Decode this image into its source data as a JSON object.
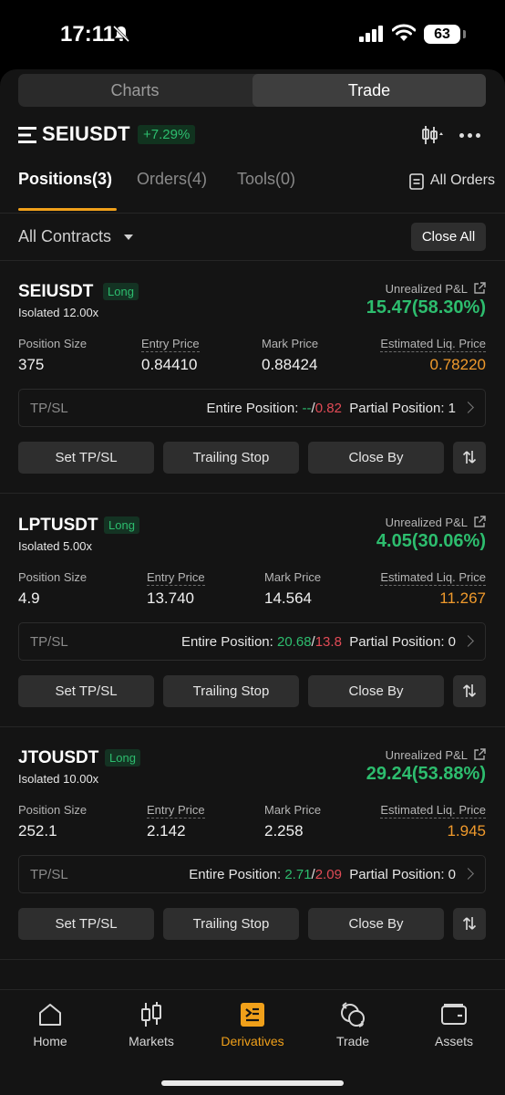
{
  "status_bar": {
    "time": "17:11",
    "battery": "63"
  },
  "segment": {
    "charts": "Charts",
    "trade": "Trade"
  },
  "header": {
    "pair": "SEIUSDT",
    "change": "+7.29%"
  },
  "tabs": {
    "positions": "Positions(3)",
    "orders": "Orders(4)",
    "tools": "Tools(0)",
    "all_orders": "All Orders"
  },
  "filter": {
    "contracts": "All Contracts",
    "close_all": "Close All"
  },
  "labels": {
    "unrealized_pnl": "Unrealized P&L",
    "position_size": "Position Size",
    "entry_price": "Entry Price",
    "mark_price": "Mark Price",
    "liq_price": "Estimated Liq. Price",
    "tpsl": "TP/SL",
    "entire_position": "Entire Position: ",
    "slash": "/",
    "partial_position": "Partial Position: ",
    "set_tpsl": "Set TP/SL",
    "trailing_stop": "Trailing Stop",
    "close_by": "Close By"
  },
  "positions": [
    {
      "symbol": "SEIUSDT",
      "side": "Long",
      "margin": "Isolated 12.00x",
      "pnl": "15.47(58.30%)",
      "size": "375",
      "entry": "0.84410",
      "mark": "0.88424",
      "liq": "0.78220",
      "tp": "--",
      "sl": "0.82",
      "partial": "1"
    },
    {
      "symbol": "LPTUSDT",
      "side": "Long",
      "margin": "Isolated 5.00x",
      "pnl": "4.05(30.06%)",
      "size": "4.9",
      "entry": "13.740",
      "mark": "14.564",
      "liq": "11.267",
      "tp": "20.68",
      "sl": "13.8",
      "partial": "0"
    },
    {
      "symbol": "JTOUSDT",
      "side": "Long",
      "margin": "Isolated 10.00x",
      "pnl": "29.24(53.88%)",
      "size": "252.1",
      "entry": "2.142",
      "mark": "2.258",
      "liq": "1.945",
      "tp": "2.71",
      "sl": "2.09",
      "partial": "0"
    }
  ],
  "nav": {
    "home": "Home",
    "markets": "Markets",
    "derivatives": "Derivatives",
    "trade": "Trade",
    "assets": "Assets"
  },
  "colors": {
    "accent": "#f0a01a",
    "positive": "#2dbd6e",
    "negative": "#e14b56",
    "liq": "#f09a2c"
  }
}
